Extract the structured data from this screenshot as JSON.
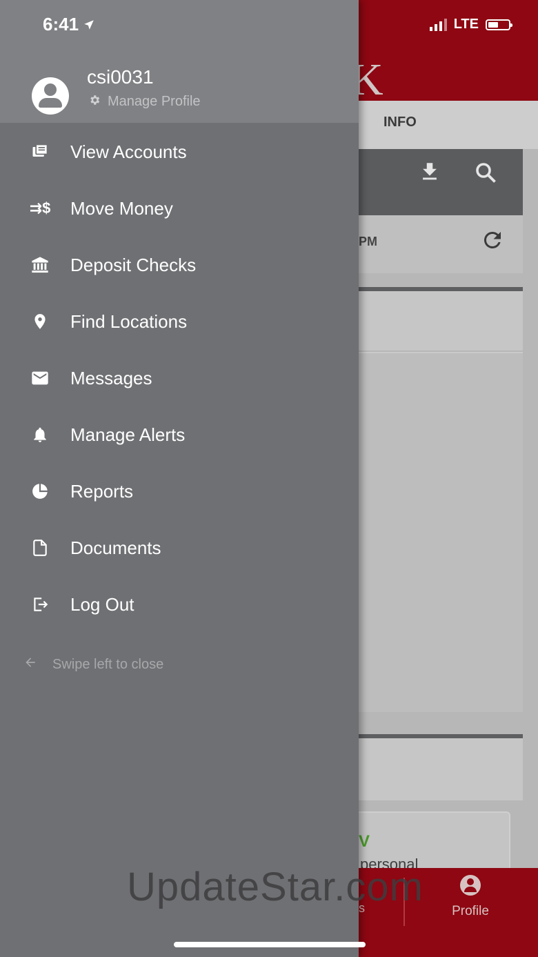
{
  "status_bar": {
    "time": "6:41",
    "network": "LTE"
  },
  "background_app": {
    "logo_letter": "K",
    "tab_info": "INFO",
    "sync_text": "PM",
    "account_check": "V",
    "account_text": "personal",
    "nav_partial": "s",
    "nav_profile_label": "Profile",
    "colors": {
      "brand": "#8e0712"
    }
  },
  "drawer": {
    "username": "csi0031",
    "manage_profile": "Manage Profile",
    "menu": [
      {
        "label": "View Accounts",
        "icon": "accounts-icon"
      },
      {
        "label": "Move Money",
        "icon": "transfer-icon"
      },
      {
        "label": "Deposit Checks",
        "icon": "bank-icon"
      },
      {
        "label": "Find Locations",
        "icon": "location-pin-icon"
      },
      {
        "label": "Messages",
        "icon": "mail-icon"
      },
      {
        "label": "Manage Alerts",
        "icon": "bell-icon"
      },
      {
        "label": "Reports",
        "icon": "pie-chart-icon"
      },
      {
        "label": "Documents",
        "icon": "document-icon"
      },
      {
        "label": "Log Out",
        "icon": "logout-icon"
      }
    ],
    "swipe_hint": "Swipe left to close"
  },
  "watermark": "UpdateStar.com"
}
